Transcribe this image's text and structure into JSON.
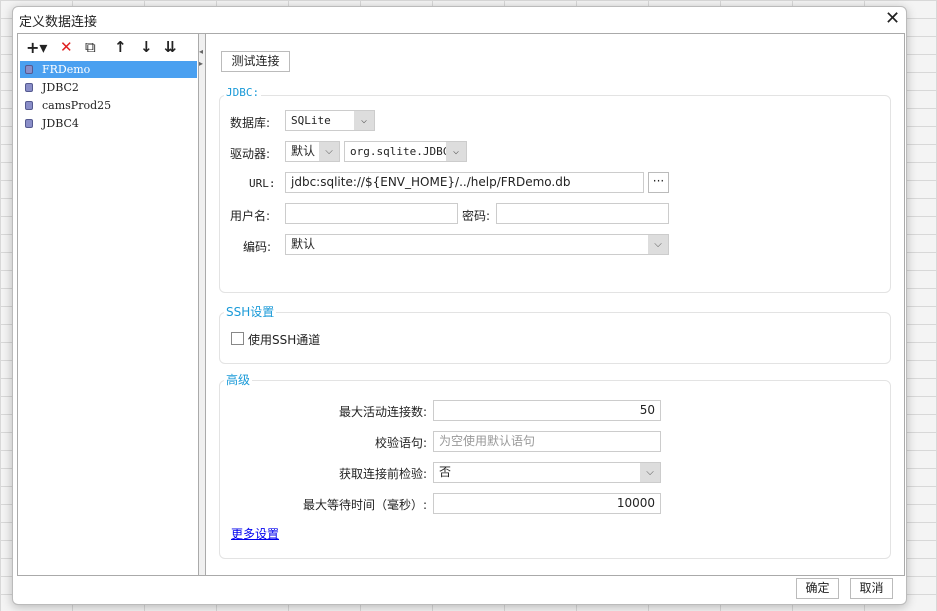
{
  "dialog": {
    "title": "定义数据连接",
    "close": "✕"
  },
  "toolbar": {
    "add": "+▾",
    "delete": "✕",
    "copy": "⧉",
    "up": "↑",
    "down": "↓",
    "sort": "⇊"
  },
  "connections": [
    "FRDemo",
    "JDBC2",
    "camsProd25",
    "JDBC4"
  ],
  "test_button": "测试连接",
  "jdbc": {
    "title": "JDBC:",
    "db_label": "数据库:",
    "db_value": "SQLite",
    "driver_label": "驱动器:",
    "driver_mode": "默认",
    "driver_value": "org.sqlite.JDBC",
    "url_label": "URL:",
    "url_value": "jdbc:sqlite://${ENV_HOME}/../help/FRDemo.db",
    "browse": "···",
    "user_label": "用户名:",
    "user_value": "",
    "pwd_label": "密码:",
    "pwd_value": "",
    "enc_label": "编码:",
    "enc_value": "默认"
  },
  "ssh": {
    "title": "SSH设置",
    "use_label": "使用SSH通道"
  },
  "advanced": {
    "title": "高级",
    "max_active_label": "最大活动连接数:",
    "max_active": "50",
    "validation_label": "校验语句:",
    "validation_placeholder": "为空使用默认语句",
    "test_before_label": "获取连接前检验:",
    "test_before": "否",
    "max_wait_label": "最大等待时间（毫秒）:",
    "max_wait": "10000",
    "more": "更多设置"
  },
  "footer": {
    "ok": "确定",
    "cancel": "取消"
  }
}
